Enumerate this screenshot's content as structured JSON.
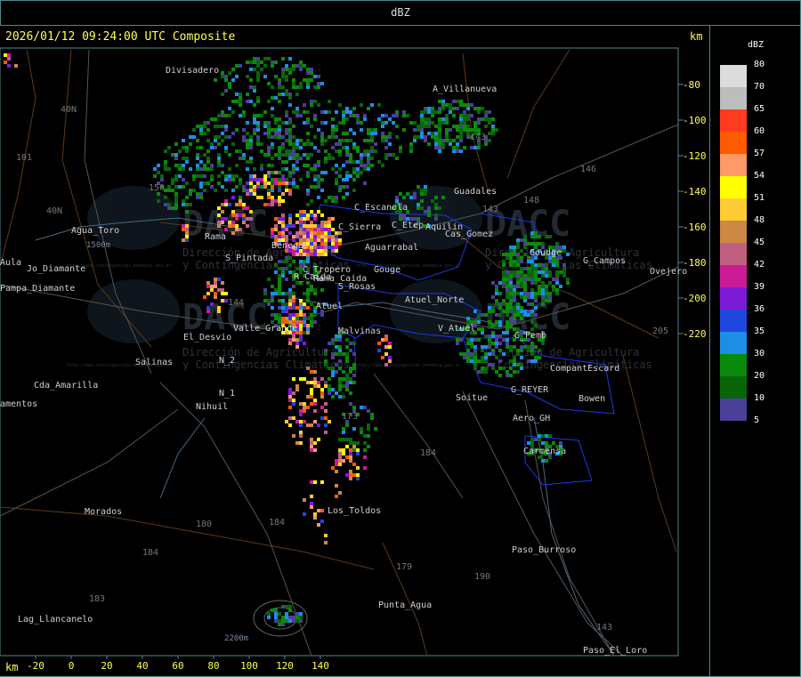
{
  "header": {
    "title": "dBZ"
  },
  "map": {
    "timestamp": "2026/01/12 09:24:00 UTC Composite",
    "unit_top": "km",
    "unit_bottom": "km",
    "y_ticks": [
      "-80",
      "-100",
      "-120",
      "-140",
      "-160",
      "-180",
      "-200",
      "-220"
    ],
    "x_ticks": [
      "-20",
      "0",
      "20",
      "40",
      "60",
      "80",
      "100",
      "120",
      "140"
    ],
    "places": [
      "Divisadero",
      "A_Villanueva",
      "Guadales",
      "Agua_Toro",
      "Rama",
      "S_Pintada",
      "Pampa_Diamante",
      "Jo_Diamante",
      "C_Escanola",
      "Benegas",
      "C_Sierra",
      "Aguarrabal",
      "C_Tropero",
      "Gouge",
      "R_Caida",
      "S_Rosas",
      "Atuel_Norte",
      "Atuel",
      "Malvinas",
      "Valle_Grande",
      "El_Desvio",
      "Salinas",
      "N_2",
      "N_1",
      "Cda_Amarilla",
      "amentos",
      "Nihuil",
      "V_Atuel",
      "G_Campos",
      "Ovejero",
      "Goudge",
      "Rama_Caida",
      "G_Pemb",
      "CompantEscard",
      "G_REYER",
      "Bowen",
      "Soitue",
      "Aero_GH",
      "Carmensa",
      "Los_Toldos",
      "Morados",
      "Paso_Burroso",
      "Punta_Agua",
      "Lag_Llancanelo",
      "Paso_El_Loro",
      "C_Etep",
      "Aquilin",
      "Cas_Gomez",
      "Aula"
    ],
    "route_labels": [
      "40N",
      "40N",
      "101",
      "150",
      "144",
      "146",
      "143",
      "148",
      "205",
      "143",
      "184",
      "184",
      "173",
      "180",
      "184",
      "183",
      "179",
      "190",
      "143"
    ],
    "elevation_labels": [
      "1500m",
      "2200m"
    ],
    "watermark": {
      "brand": "DACC",
      "line1": "Dirección de Agricultura",
      "line2": "y Contingencias Climáticas",
      "url": "http://www.contingencias.mendoza.gov.ar"
    }
  },
  "legend": {
    "title": "dBZ",
    "levels": [
      {
        "label": "80",
        "color": "#dcdcdc"
      },
      {
        "label": "70",
        "color": "#bdbdbd"
      },
      {
        "label": "65",
        "color": "#ff3a1e"
      },
      {
        "label": "60",
        "color": "#ff5a00"
      },
      {
        "label": "57",
        "color": "#ff9966"
      },
      {
        "label": "54",
        "color": "#ffff00"
      },
      {
        "label": "51",
        "color": "#ffcc33"
      },
      {
        "label": "48",
        "color": "#cc8844"
      },
      {
        "label": "45",
        "color": "#c06080"
      },
      {
        "label": "42",
        "color": "#cc1b99"
      },
      {
        "label": "39",
        "color": "#7d1bd6"
      },
      {
        "label": "36",
        "color": "#2046e0"
      },
      {
        "label": "35",
        "color": "#1d8ee6"
      },
      {
        "label": "30",
        "color": "#0a8a0a"
      },
      {
        "label": "20",
        "color": "#086608"
      },
      {
        "label": "10",
        "color": "#4a3f99"
      }
    ],
    "bottom_label": "5"
  }
}
